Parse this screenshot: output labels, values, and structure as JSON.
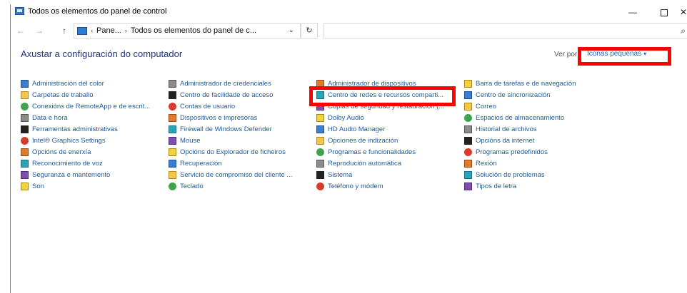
{
  "window": {
    "title": "Todos os elementos do panel de control",
    "minimize": "—",
    "close": "✕"
  },
  "nav": {
    "back": "←",
    "forward": "→",
    "up": "↑",
    "breadcrumb": [
      "Pane...",
      "Todos os elementos do panel de c..."
    ],
    "breadcrumb_sep": "›",
    "dropdown": "⌄",
    "refresh": "↻",
    "search_placeholder": "",
    "search_icon": "⌕"
  },
  "heading": "Axustar a configuración do computador",
  "view_by": {
    "label": "Ver por:",
    "value": "Iconas pequenas",
    "caret": "▾"
  },
  "highlight_color": "#ff0000",
  "items": {
    "col1": [
      {
        "label": "Administración del color",
        "icon": "color-management-icon"
      },
      {
        "label": "Carpetas de traballo",
        "icon": "work-folders-icon"
      },
      {
        "label": "Conexións de RemoteApp e de escrit...",
        "icon": "remoteapp-icon"
      },
      {
        "label": "Data e hora",
        "icon": "date-time-icon"
      },
      {
        "label": "Ferramentas administrativas",
        "icon": "admin-tools-icon"
      },
      {
        "label": "Intel® Graphics Settings",
        "icon": "intel-graphics-icon"
      },
      {
        "label": "Opcións de enerxía",
        "icon": "power-options-icon"
      },
      {
        "label": "Reconocimiento de voz",
        "icon": "speech-recognition-icon"
      },
      {
        "label": "Seguranza e mantemento",
        "icon": "security-maintenance-icon"
      },
      {
        "label": "Son",
        "icon": "sound-icon"
      }
    ],
    "col2": [
      {
        "label": "Administrador de credenciales",
        "icon": "credential-manager-icon"
      },
      {
        "label": "Centro de facilidade de acceso",
        "icon": "ease-of-access-icon"
      },
      {
        "label": "Contas de usuario",
        "icon": "user-accounts-icon"
      },
      {
        "label": "Dispositivos e impresoras",
        "icon": "devices-printers-icon"
      },
      {
        "label": "Firewall de Windows Defender",
        "icon": "firewall-icon"
      },
      {
        "label": "Mouse",
        "icon": "mouse-icon"
      },
      {
        "label": "Opcións do Explorador de ficheiros",
        "icon": "file-explorer-options-icon"
      },
      {
        "label": "Recuperación",
        "icon": "recovery-icon"
      },
      {
        "label": "Servicio de compromiso del cliente ...",
        "icon": "customer-engagement-icon"
      },
      {
        "label": "Teclado",
        "icon": "keyboard-icon"
      }
    ],
    "col3": [
      {
        "label": "Administrador de dispositivos",
        "icon": "device-manager-icon"
      },
      {
        "label": "Centro de redes e recursos comparti...",
        "icon": "network-sharing-icon"
      },
      {
        "label": "Copias de seguridad y restauración (...",
        "icon": "backup-restore-icon"
      },
      {
        "label": "Dolby Audio",
        "icon": "dolby-audio-icon"
      },
      {
        "label": "HD Audio Manager",
        "icon": "hd-audio-icon"
      },
      {
        "label": "Opciones de indización",
        "icon": "indexing-options-icon"
      },
      {
        "label": "Programas e funcionalidades",
        "icon": "programs-features-icon"
      },
      {
        "label": "Reprodución automática",
        "icon": "autoplay-icon"
      },
      {
        "label": "Sistema",
        "icon": "system-icon"
      },
      {
        "label": "Teléfono y módem",
        "icon": "phone-modem-icon"
      }
    ],
    "col4": [
      {
        "label": "Barra de tarefas e de navegación",
        "icon": "taskbar-icon"
      },
      {
        "label": "Centro de sincronización",
        "icon": "sync-center-icon"
      },
      {
        "label": "Correo",
        "icon": "mail-icon"
      },
      {
        "label": "Espacios de almacenamiento",
        "icon": "storage-spaces-icon"
      },
      {
        "label": "Historial de archivos",
        "icon": "file-history-icon"
      },
      {
        "label": "Opcións da internet",
        "icon": "internet-options-icon"
      },
      {
        "label": "Programas predefinidos",
        "icon": "default-programs-icon"
      },
      {
        "label": "Rexión",
        "icon": "region-icon"
      },
      {
        "label": "Solución de problemas",
        "icon": "troubleshooting-icon"
      },
      {
        "label": "Tipos de letra",
        "icon": "fonts-icon"
      }
    ]
  }
}
